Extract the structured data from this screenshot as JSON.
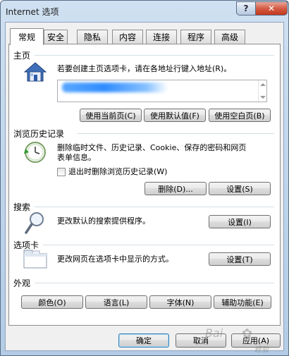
{
  "window": {
    "title": "Internet 选项",
    "help_label": "?",
    "close_label": "✕"
  },
  "tabs": [
    {
      "label": "常规",
      "active": true
    },
    {
      "label": "安全"
    },
    {
      "label": "隐私"
    },
    {
      "label": "内容"
    },
    {
      "label": "连接"
    },
    {
      "label": "程序"
    },
    {
      "label": "高级"
    }
  ],
  "home": {
    "title": "主页",
    "description": "若要创建主页选项卡，请在各地址行键入地址(R)。",
    "btn_current": "使用当前页(C)",
    "btn_default": "使用默认值(F)",
    "btn_blank": "使用空白页(B)"
  },
  "history": {
    "title": "浏览历史记录",
    "description_line1": "删除临时文件、历史记录、Cookie、保存的密码和网页",
    "description_line2": "表单信息。",
    "checkbox_label": "退出时删除浏览历史记录(W)",
    "btn_delete": "删除(D)...",
    "btn_settings": "设置(S)"
  },
  "search": {
    "title": "搜索",
    "description": "更改默认的搜索提供程序。",
    "btn_settings": "设置(I)"
  },
  "tabs_section": {
    "title": "选项卡",
    "description": "更改网页在选项卡中显示的方式。",
    "btn_settings": "设置(T)"
  },
  "appearance": {
    "title": "外观",
    "btn_colors": "颜色(O)",
    "btn_languages": "语言(L)",
    "btn_fonts": "字体(N)",
    "btn_accessibility": "辅助功能(E)"
  },
  "footer": {
    "btn_ok": "确定",
    "btn_cancel": "取消",
    "btn_apply": "应用(A)"
  },
  "watermark": {
    "text": "Bai",
    "text2": "经验"
  }
}
